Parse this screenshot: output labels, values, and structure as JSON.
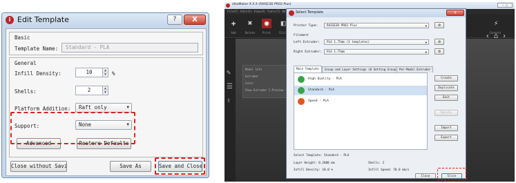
{
  "edit_dialog": {
    "title": "Edit Template",
    "help_glyph": "?",
    "close_glyph": "X",
    "basic_group": {
      "title": "Basic",
      "template_name_label": "Template Name:",
      "template_name_value": "Standard - PLA"
    },
    "general_group": {
      "title": "General",
      "infill_label": "Infill Density:",
      "infill_value": "10",
      "infill_unit": "%",
      "shells_label": "Shells:",
      "shells_value": "2",
      "platform_label": "Platform Addition:",
      "platform_value": "Raft only",
      "support_label": "Support:",
      "support_value": "None",
      "advanced_button": "Advanced",
      "restore_button": "Restore Defaults"
    },
    "footer": {
      "close_without_saving": "Close without Saving",
      "save_as": "Save As",
      "save_and_close": "Save and Close"
    }
  },
  "ideamaker": {
    "window_title": "ideaMaker X.X.X (RAISE3D PRO2 Plus)",
    "menu_text": "File(F)  Edit(E)  View(V)  Tools(T)  Help(H)",
    "toolbar": [
      "Add",
      "Delete",
      "Print",
      "Slice"
    ],
    "toolbar_right": "Connect",
    "panel": {
      "line1": "Model Info",
      "line2": "Extruder",
      "line3": "Color",
      "line4": "Show Extruder 1 Preview"
    },
    "select_dialog": {
      "title": "Select Template",
      "printer_label": "Printer Type:",
      "printer_value": "RAISE3D PRO2 Plus",
      "filament_label": "Filament",
      "left_label": "Left Extruder:",
      "left_value": "PLA 1.75mm (3 templates)",
      "right_label": "Right Extruder:",
      "right_value": "PLA 1.75mm",
      "gear_glyph": "⚙",
      "tabs": [
        "Main Template",
        "Group and Layer Settings (0 Setting Groups)",
        "Per-Model Extruder"
      ],
      "templates": [
        {
          "name": "High Quality - PLA",
          "color": "#3aa34a",
          "selected": false
        },
        {
          "name": "Standard - PLA",
          "color": "#3aa34a",
          "selected": true
        },
        {
          "name": "Speed - PLA",
          "color": "#e2561d",
          "selected": false
        }
      ],
      "buttons": [
        "Create",
        "Duplicate",
        "Edit",
        "Delete",
        "Import",
        "Export"
      ],
      "info": {
        "selected": "Select Template: Standard - PLA",
        "layer_height": "Layer Height: 0.2000 mm",
        "shells": "Shells: 2",
        "infill_density": "Infill Density: 10.0 %",
        "infill_speed": "Infill Speed: 70.0 mm/s"
      },
      "close_button": "Close",
      "slice_button": "Slice"
    }
  }
}
